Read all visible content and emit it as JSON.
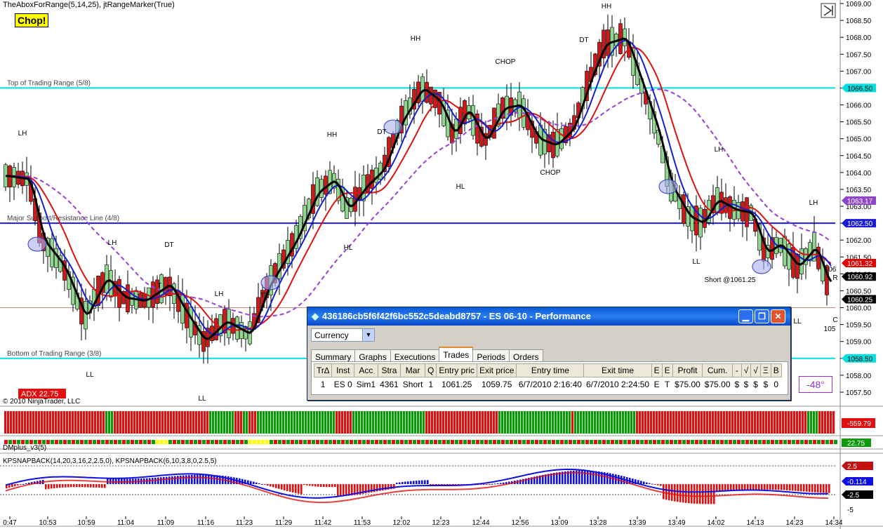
{
  "header": {
    "indicator_text": "TheAboxForRange(5,14,25), jtRangeMarker(True)",
    "chop_label": "Chop!"
  },
  "price_axis": {
    "ticks": [
      "1069.00",
      "1068.50",
      "1068.00",
      "1067.50",
      "1067.00",
      "1066.50",
      "1066.00",
      "1065.50",
      "1065.00",
      "1064.50",
      "1064.00",
      "1063.50",
      "1063.00",
      "1062.50",
      "1062.00",
      "1061.50",
      "1061.00",
      "1060.50",
      "1060.00",
      "1059.50",
      "1059.00",
      "1058.50",
      "1058.00",
      "1057.50"
    ],
    "markers": [
      {
        "label": "1066.50",
        "color": "#00e0e0",
        "text_color": "#000"
      },
      {
        "label": "1063.17",
        "color": "#8e44c8",
        "text_color": "#fff"
      },
      {
        "label": "1062.50",
        "color": "#1a1ad8",
        "text_color": "#fff"
      },
      {
        "label": "1061.32",
        "color": "#e00000",
        "text_color": "#fff"
      },
      {
        "label": "1060.92",
        "color": "#000000",
        "text_color": "#fff"
      },
      {
        "label": "1060.25",
        "color": "#000000",
        "text_color": "#fff"
      },
      {
        "label": "1058.50",
        "color": "#00e0e0",
        "text_color": "#000"
      }
    ]
  },
  "lines": {
    "top_range": "Top of Trading Range (5/8)",
    "major_support": "Major Support/Resistance Line (4/8)",
    "bottom_range": "Bottom of Trading Range (3/8)"
  },
  "annotations": [
    "LH",
    "LL",
    "LH",
    "DT",
    "T",
    "LH",
    "LL",
    "TT",
    "HL",
    "HH",
    "HH",
    "DT",
    "HL",
    "CHOP",
    "CHOP",
    "DT",
    "HH",
    "LH",
    "LL",
    "LL",
    "LH",
    "Short @1061.25",
    "106",
    "R",
    "C",
    "105"
  ],
  "copyright": "© 2010 NinjaTrader, LLC",
  "adx_label": "ADX 22.75",
  "angle_label": "-48°",
  "panels": {
    "dmplus_label": "DMplus_v3(5)",
    "dmplus_value": "-559.79",
    "dmplus_small_value": "22.75",
    "kp_label": "KPSNAPBACK(14,20,3,16,2,2.5,0), KPSNAPBACK(6,10,3,8,0,2.5,5)",
    "kp_ticks": [
      "2.5",
      "-0.114",
      "-2.5",
      "-5"
    ]
  },
  "time_axis": [
    "0:47",
    "10:53",
    "10:59",
    "11:04",
    "11:09",
    "11:16",
    "11:23",
    "11:29",
    "11:42",
    "11:53",
    "12:02",
    "12:23",
    "12:44",
    "12:56",
    "13:09",
    "13:28",
    "13:39",
    "13:49",
    "14:02",
    "14:13",
    "14:23",
    "14:34"
  ],
  "performance_window": {
    "title": "436186cb5f6f42f6bc552c5deabd8757 - ES 06-10 - Performance",
    "display_unit": "Currency",
    "tabs": [
      "Summary",
      "Graphs",
      "Executions",
      "Trades",
      "Periods",
      "Orders"
    ],
    "active_tab": "Trades",
    "columns": [
      "Tr∆",
      "Inst",
      "Acc",
      "Stra",
      "Mar",
      "Q",
      "Entry pric",
      "Exit price",
      "Entry time",
      "Exit time",
      "E",
      "E",
      "Profit",
      "Cum.",
      "-",
      "√",
      "√",
      "Ξ",
      "B"
    ],
    "rows": [
      [
        "1",
        "ES 0",
        "Sim1",
        "4361",
        "Short",
        "1",
        "1061.25",
        "1059.75",
        "6/7/2010 2:16:40",
        "6/7/2010 2:24:50",
        "E",
        "T",
        "$75.00",
        "$75.00",
        "$",
        "$",
        "$",
        "$",
        "0"
      ]
    ]
  },
  "colors": {
    "up_bar": "#90d890",
    "down_bar": "#d01818",
    "fast_ma": "#000000",
    "mid_ma": "#1020d0",
    "red_ma": "#e01010",
    "purple_dash": "#9a40d8",
    "cyan_line": "#00e0e0"
  }
}
